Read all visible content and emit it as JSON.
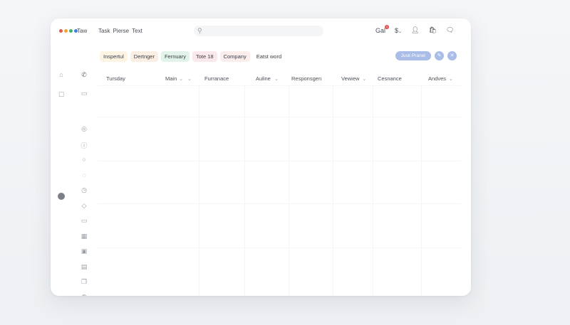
{
  "titlebar": {
    "dots": [
      "#e0584e",
      "#f0a53a",
      "#3fb26b",
      "#3f7fe0"
    ],
    "app_name": "Taw",
    "menu": [
      "Task",
      "Pierse",
      "Text"
    ],
    "mail_label": "Gal",
    "badge_count": "4",
    "currency_label": "$",
    "currency_chevron": "⌄"
  },
  "toolbar": {
    "chips": [
      {
        "label": "Inspertul",
        "bg": "#fdf4e4"
      },
      {
        "label": "Dertnger",
        "bg": "#fbefe3"
      },
      {
        "label": "Fernuary",
        "bg": "#e2f4ea"
      },
      {
        "label": "Tote 18",
        "bg": "#fbe8ea"
      },
      {
        "label": "Company",
        "bg": "#fdeeee"
      },
      {
        "label": "Eatst word",
        "bg": "#ffffff"
      }
    ],
    "action_label": "Jusk Pranet"
  },
  "table": {
    "columns": [
      "Tursday",
      "Main",
      "Furranace",
      "Auline",
      "Responsgen",
      "Vewiew",
      "Cesnance",
      "Andves"
    ]
  }
}
